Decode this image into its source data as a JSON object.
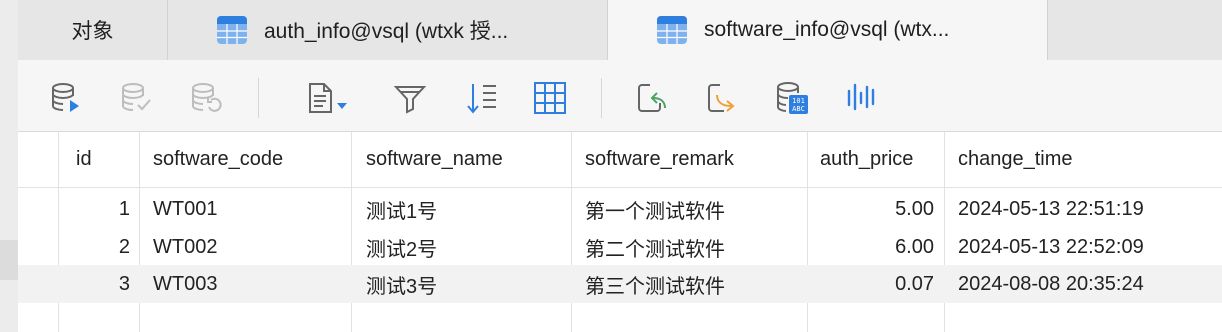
{
  "tabs": {
    "objects": "对象",
    "tab1": "auth_info@vsql (wtxk 授...",
    "tab2": "software_info@vsql (wtx..."
  },
  "toolbar_icons": [
    "begin-transaction-icon",
    "commit-icon",
    "rollback-icon",
    "text-view-icon",
    "filter-icon",
    "sort-icon",
    "grid-view-icon",
    "import-icon",
    "export-icon",
    "data-generation-icon",
    "profile-icon"
  ],
  "table": {
    "columns": [
      "id",
      "software_code",
      "software_name",
      "software_remark",
      "auth_price",
      "change_time"
    ],
    "rows": [
      {
        "id": "1",
        "software_code": "WT001",
        "software_name": "测试1号",
        "software_remark": "第一个测试软件",
        "auth_price": "5.00",
        "change_time": "2024-05-13 22:51:19"
      },
      {
        "id": "2",
        "software_code": "WT002",
        "software_name": "测试2号",
        "software_remark": "第二个测试软件",
        "auth_price": "6.00",
        "change_time": "2024-05-13 22:52:09"
      },
      {
        "id": "3",
        "software_code": "WT003",
        "software_name": "测试3号",
        "software_remark": "第三个测试软件",
        "auth_price": "0.07",
        "change_time": "2024-08-08 20:35:24"
      }
    ]
  },
  "colors": {
    "accent": "#2f7fe0",
    "orange": "#f0a030",
    "green": "#4aa564"
  }
}
